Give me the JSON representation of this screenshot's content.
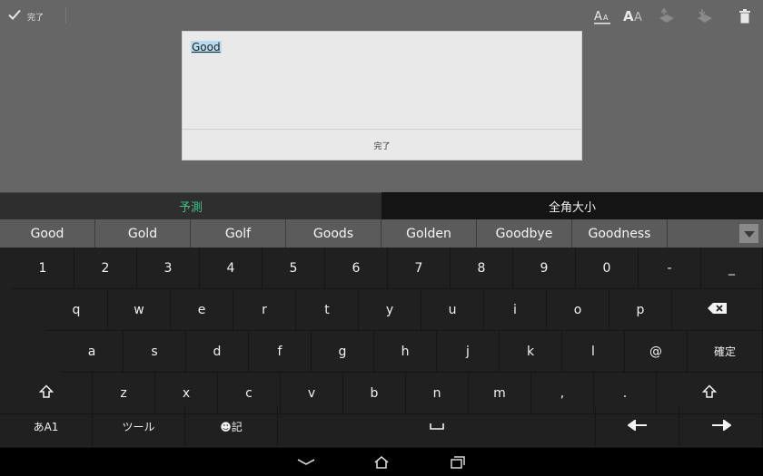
{
  "actionbar": {
    "done_label": "完了",
    "tools": [
      "font-size-small-icon",
      "font-size-large-icon",
      "move-up-icon",
      "move-down-icon",
      "trash-icon"
    ]
  },
  "dialog": {
    "text": "Good",
    "done_label": "完了"
  },
  "keyboard": {
    "modes": [
      "予測",
      "全角大小"
    ],
    "candidates": [
      "Good",
      "Gold",
      "Golf",
      "Goods",
      "Golden",
      "Goodbye",
      "Goodness"
    ],
    "row1": [
      "1",
      "2",
      "3",
      "4",
      "5",
      "6",
      "7",
      "8",
      "9",
      "0",
      "-",
      "_"
    ],
    "row2": [
      "q",
      "w",
      "e",
      "r",
      "t",
      "y",
      "u",
      "i",
      "o",
      "p"
    ],
    "row3": [
      "a",
      "s",
      "d",
      "f",
      "g",
      "h",
      "j",
      "k",
      "l",
      "@"
    ],
    "enter_label": "確定",
    "row4": [
      "z",
      "x",
      "c",
      "v",
      "b",
      "n",
      "m",
      ",",
      "."
    ],
    "input_mode_label": "あA1",
    "tools_label": "ツール",
    "emoji_label": "☻記"
  },
  "colors": {
    "accent": "#3fbf86",
    "key_bg": "#202020",
    "candidate_bg": "#5b5b5b",
    "editor_bg": "#666666",
    "dialog_bg": "#e9e9e9"
  }
}
